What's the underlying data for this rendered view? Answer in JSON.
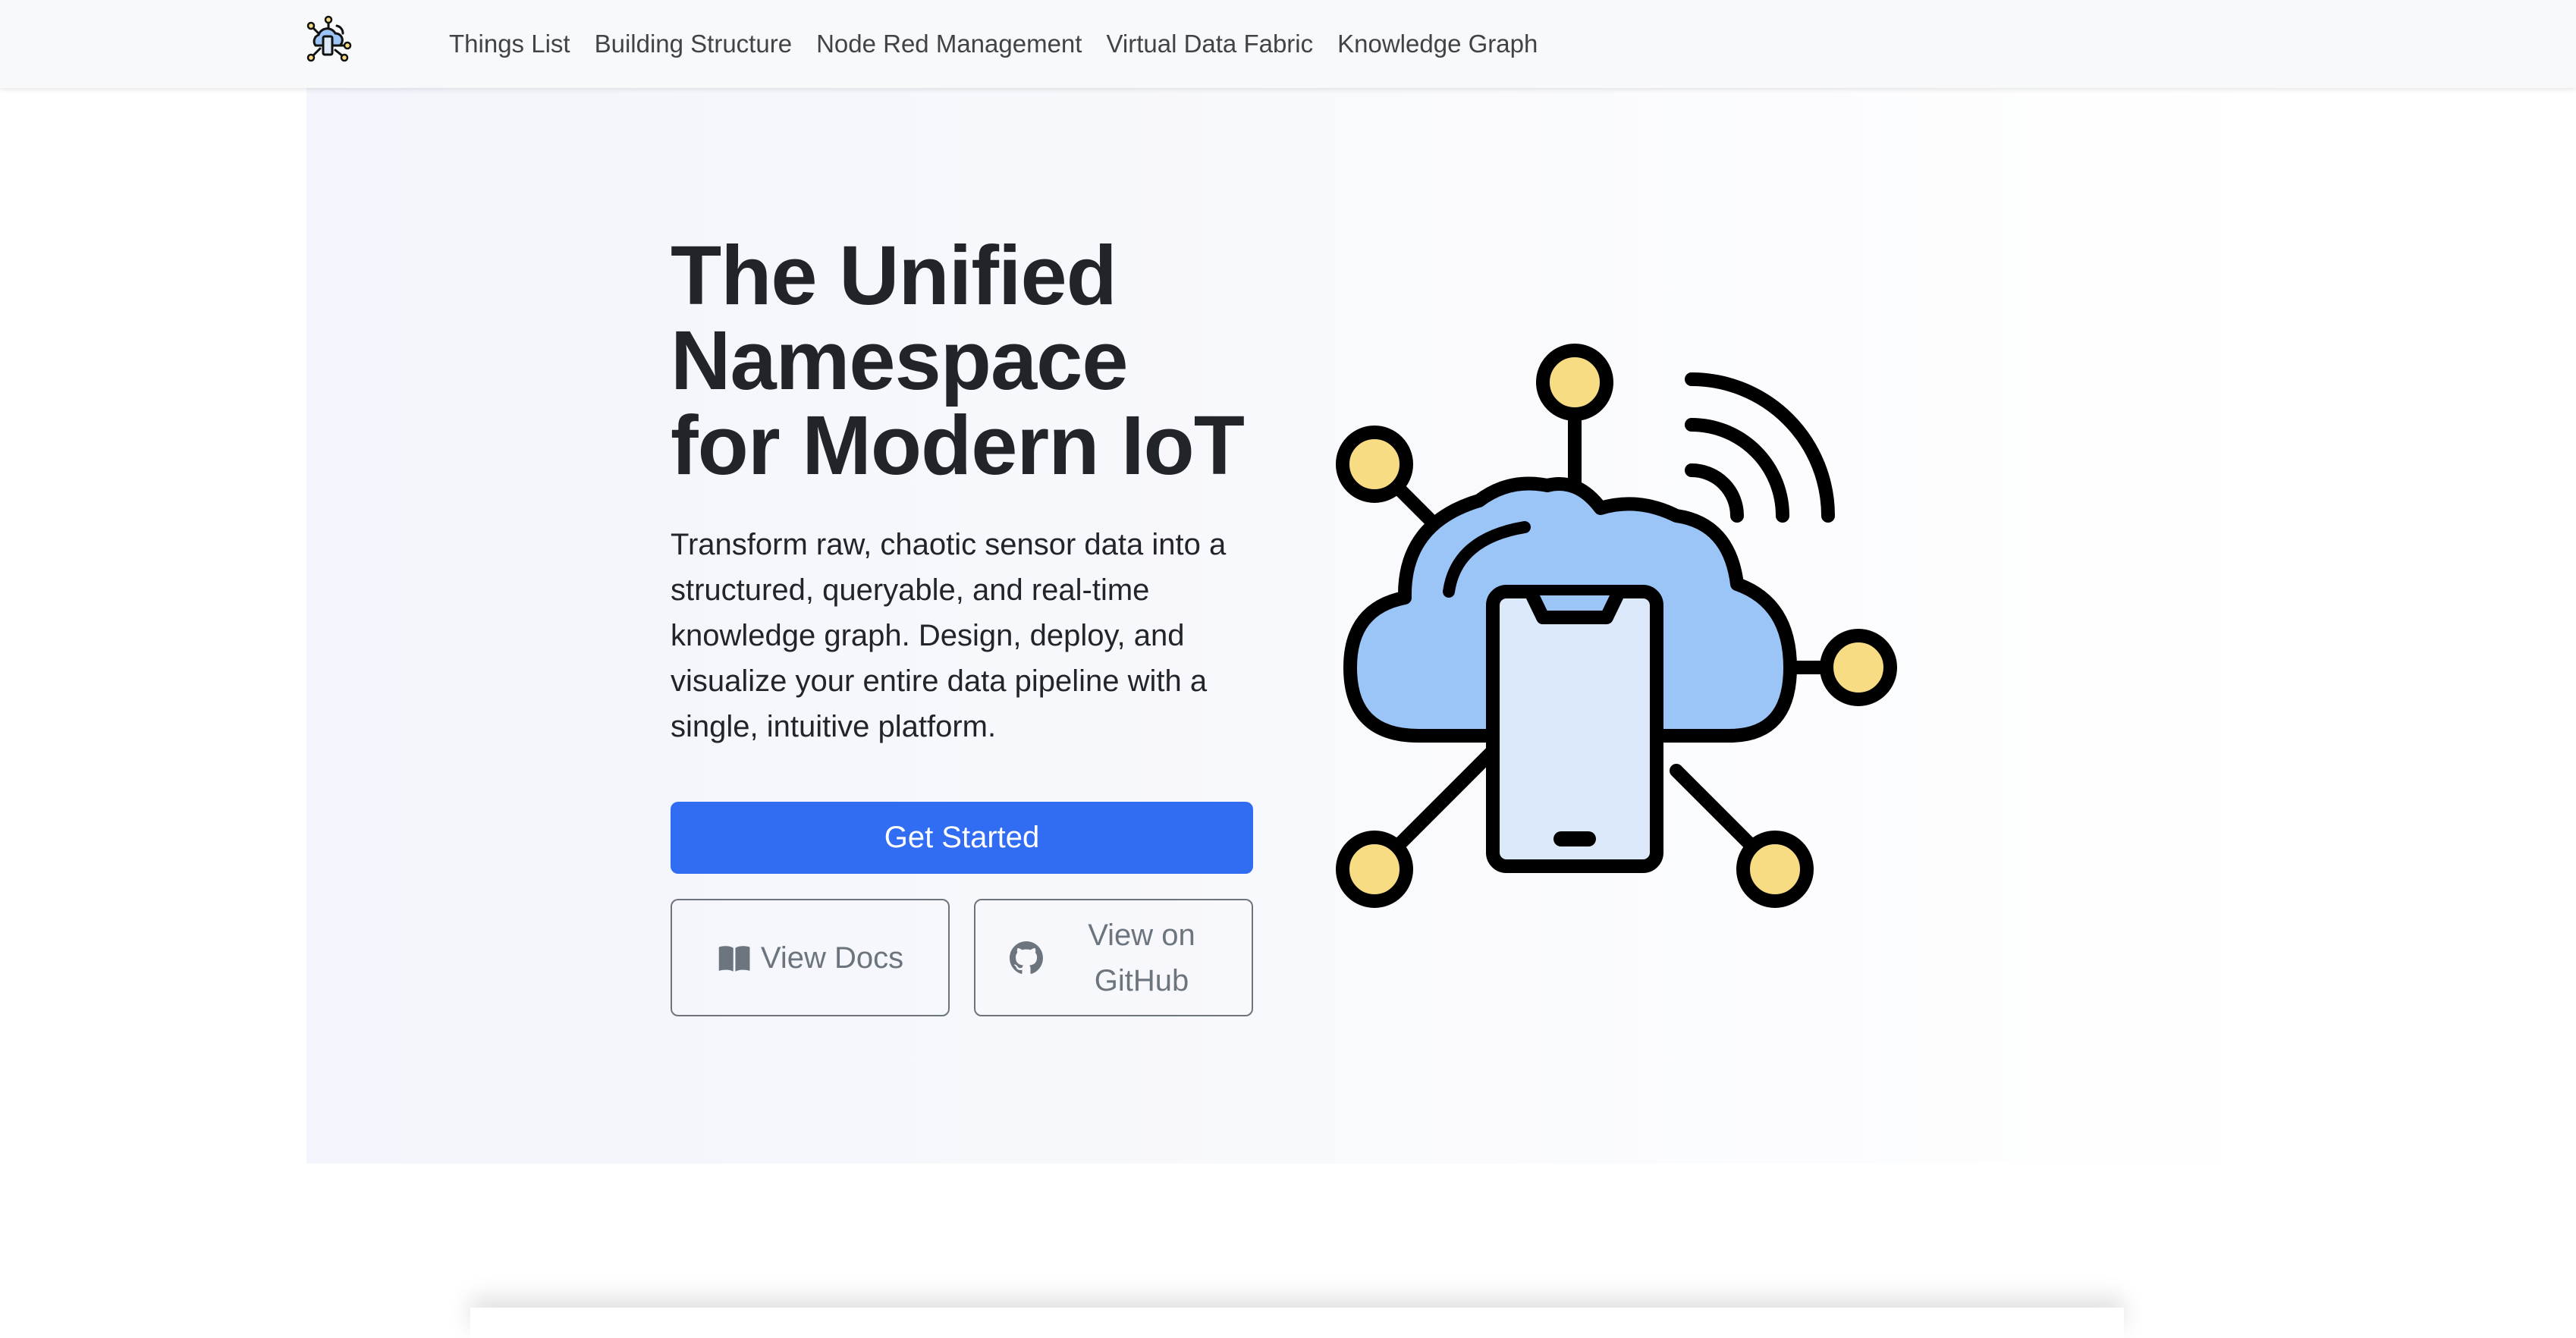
{
  "navbar": {
    "brand_icon": "iot-cloud-logo-icon",
    "links": [
      {
        "label": "Things List"
      },
      {
        "label": "Building Structure"
      },
      {
        "label": "Node Red Management"
      },
      {
        "label": "Virtual Data Fabric"
      },
      {
        "label": "Knowledge Graph"
      }
    ]
  },
  "hero": {
    "title_lines": [
      "The Unified",
      "Namespace",
      "for Modern IoT"
    ],
    "lead": "Transform raw, chaotic sensor data into a structured, queryable, and real-time knowledge graph. Design, deploy, and visualize your entire data pipeline with a single, intuitive platform.",
    "primary_button": "Get Started",
    "docs_button": "View Docs",
    "docs_icon": "book-icon",
    "github_button": "View on GitHub",
    "github_icon": "github-icon",
    "illustration": "cloud-phone-network-icon"
  },
  "colors": {
    "primary": "#316df2",
    "outline": "#6c757d",
    "cloud": "#9cc5f7",
    "phone_screen": "#dbe9fb",
    "node": "#f7dc84"
  }
}
